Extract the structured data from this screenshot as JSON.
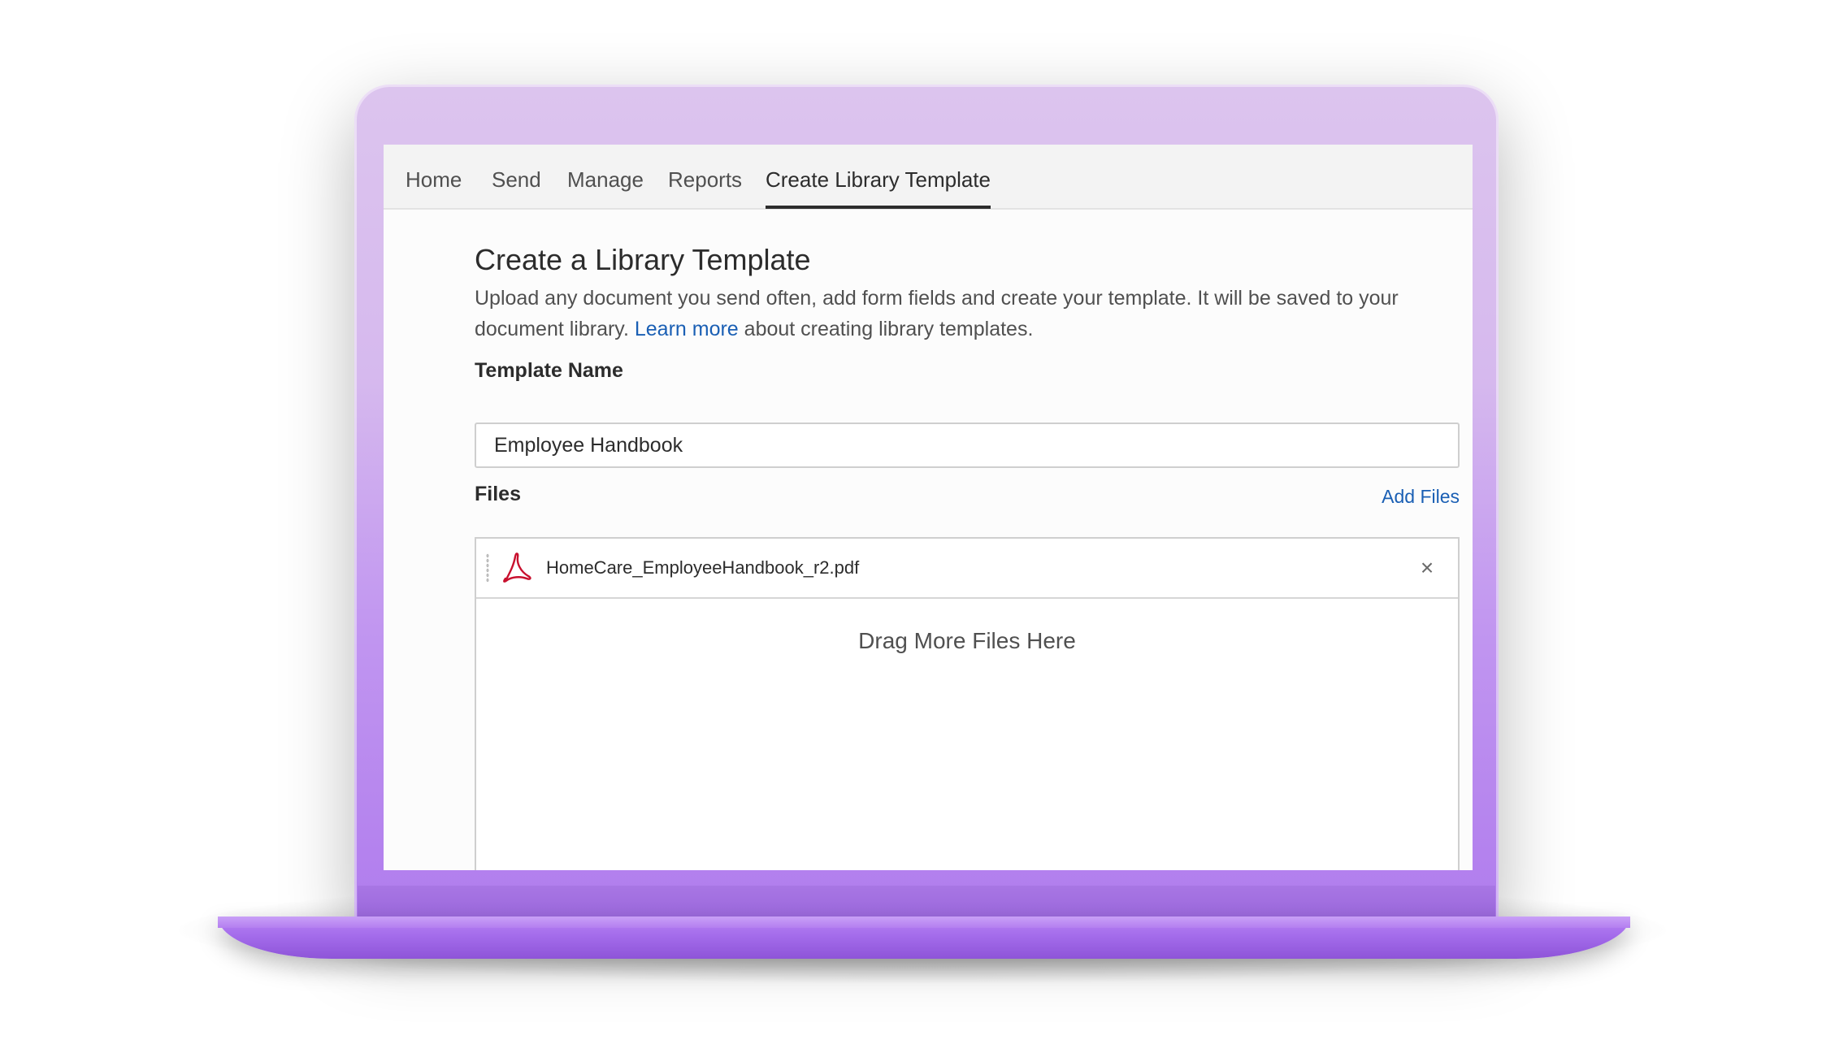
{
  "tabs": [
    {
      "label": "Home"
    },
    {
      "label": "Send"
    },
    {
      "label": "Manage"
    },
    {
      "label": "Reports"
    },
    {
      "label": "Create Library Template",
      "active": true
    }
  ],
  "page": {
    "title": "Create a Library Template",
    "description_before": "Upload any document you send often, add form fields and create your template. It will be saved to your document library.",
    "learn_more": "Learn more",
    "description_after": "about creating library templates."
  },
  "template_name": {
    "label": "Template Name",
    "value": "Employee Handbook"
  },
  "files": {
    "label": "Files",
    "add_files": "Add Files",
    "items": [
      {
        "name": "HomeCare_EmployeeHandbook_r2.pdf",
        "icon": "pdf-icon"
      }
    ],
    "drop_text": "Drag More Files Here",
    "remove_glyph": "×"
  },
  "colors": {
    "link": "#1a5fb4",
    "active_tab_underline": "#2c2c2c",
    "laptop_purple": "#b07ced",
    "pdf_red": "#c8102e"
  }
}
